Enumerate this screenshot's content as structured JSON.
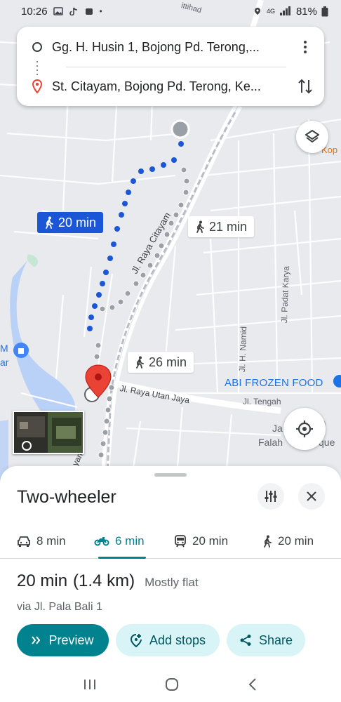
{
  "status_bar": {
    "time": "10:26",
    "signal_text": "4G",
    "battery": "81%"
  },
  "directions": {
    "origin": "Gg. H. Husin 1, Bojong Pd. Terong,...",
    "destination": "St. Citayam, Bojong Pd. Terong, Ke..."
  },
  "map": {
    "route_chips": [
      {
        "label": "20 min",
        "selected": true
      },
      {
        "label": "21 min",
        "selected": false
      },
      {
        "label": "26 min",
        "selected": false
      }
    ],
    "labels": {
      "road1": "Jl. Raya Citayam",
      "road2": "Jl. Raya Utan Jaya",
      "road3": "Jl. Padat Karya",
      "road4": "Jl. H. Namid",
      "road5": "Jl. Tengah",
      "road6": "ittihad",
      "road7": "yam",
      "poi_blue": "ABI FROZEN FOOD",
      "poi_orange": "Kop",
      "poi_edge1": "M",
      "poi_edge2": "ar",
      "mosque_a": "Ja",
      "mosque_b": "Falah",
      "mosque_c": "que",
      "bottom_road": "yam"
    }
  },
  "sheet": {
    "mode_title": "Two-wheeler",
    "tabs": [
      {
        "name": "car",
        "label": "8 min"
      },
      {
        "name": "two-wheeler",
        "label": "6 min"
      },
      {
        "name": "transit",
        "label": "20 min"
      },
      {
        "name": "walk",
        "label": "20 min"
      }
    ],
    "duration": "20 min",
    "distance": "(1.4 km)",
    "terrain": "Mostly flat",
    "via": "via Jl. Pala Bali 1",
    "buttons": {
      "preview": "Preview",
      "add_stops": "Add stops",
      "share": "Share"
    }
  },
  "colors": {
    "accent": "#00838f",
    "route_blue": "#1a56d6",
    "pin_red": "#ea4335"
  }
}
